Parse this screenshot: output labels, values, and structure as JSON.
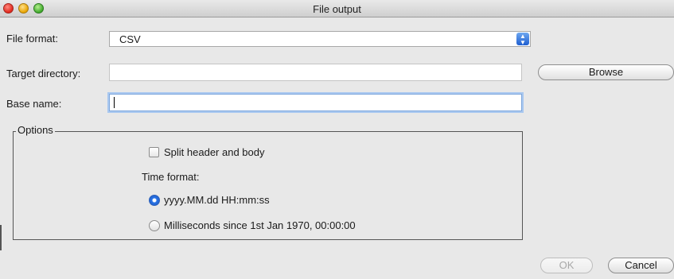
{
  "window": {
    "title": "File output"
  },
  "form": {
    "file_format_label": "File format:",
    "file_format_value": "CSV",
    "target_directory_label": "Target directory:",
    "target_directory_value": "",
    "browse_label": "Browse",
    "base_name_label": "Base name:",
    "base_name_value": ""
  },
  "options": {
    "legend": "Options",
    "split_header_label": "Split header and body",
    "split_header_checked": false,
    "time_format_label": "Time format:",
    "time_formats": [
      {
        "label": "yyyy.MM.dd HH:mm:ss",
        "selected": true
      },
      {
        "label": "Milliseconds since 1st Jan 1970, 00:00:00",
        "selected": false
      }
    ]
  },
  "footer": {
    "ok_label": "OK",
    "ok_enabled": false,
    "cancel_label": "Cancel"
  },
  "colors": {
    "focus_ring": "#a9c8f0",
    "radio_selected": "#2a74e6",
    "select_arrow": "#1f5fd0"
  }
}
